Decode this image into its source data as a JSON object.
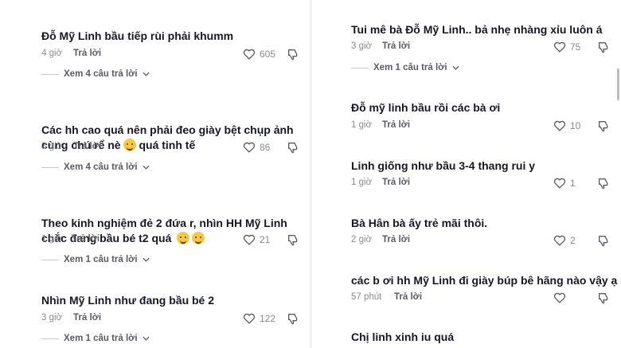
{
  "left": [
    {
      "text": "Đỗ Mỹ Linh bầu tiếp rùi phải khumm",
      "time": "4 giờ",
      "reply": "Trả lời",
      "likes": "605",
      "replies": "Xem 4 câu trả lời"
    },
    {
      "text": "Các hh cao quá nên phải đeo giày bệt chụp ảnh\ncùng chú rể nè",
      "text_after": "quá tinh tế",
      "time": "3 giờ",
      "reply": "Trả lời",
      "likes": "86",
      "replies": "Xem 4 câu trả lời"
    },
    {
      "text": "Theo kinh nghiệm đẻ 2 đứa r, nhìn HH Mỹ Linh\nchắc đang bầu bé t2 quá",
      "time": "1 giờ",
      "reply": "Trả lời",
      "likes": "21",
      "replies": "Xem 1 câu trả lời"
    },
    {
      "text": "Nhìn Mỹ Linh như đang bầu bé 2",
      "time": "3 giờ",
      "reply": "Trả lời",
      "likes": "122",
      "replies": "Xem 1 câu trả lời"
    }
  ],
  "right": [
    {
      "text": "Tui mê bà Đỗ Mỹ Linh.. bả nhẹ nhàng xỉu luôn á",
      "time": "3 giờ",
      "reply": "Trả lời",
      "likes": "75",
      "replies": "Xem 1 câu trả lời"
    },
    {
      "text": "Đỗ mỹ linh bầu rồi các bà ơi",
      "time": "1 giờ",
      "reply": "Trả lời",
      "likes": "10"
    },
    {
      "text": "Linh giống như bầu 3-4 thang rui y",
      "time": "1 giờ",
      "reply": "Trả lời",
      "likes": "1"
    },
    {
      "text": "Bà Hân bà ấy trẻ mãi thôi.",
      "time": "2 giờ",
      "reply": "Trả lời",
      "likes": "2"
    },
    {
      "text": "các b ơi hh Mỹ Linh đi giày búp bê hãng nào vậy ạ",
      "time": "57 phút",
      "reply": "Trả lời",
      "likes": ""
    },
    {
      "text": "Chị linh xinh iu quá"
    }
  ],
  "icons": {
    "like": "heart-outline-icon",
    "dislike": "thumb-down-outline-icon",
    "expand": "chevron-down-icon"
  }
}
